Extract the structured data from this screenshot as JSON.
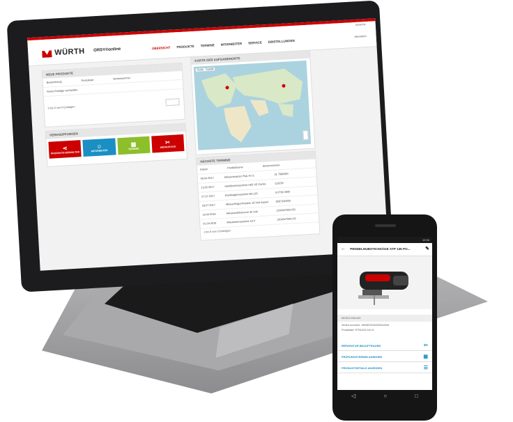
{
  "laptop": {
    "top_links": "Sprache",
    "logo_text": "WÜRTH",
    "logo_sub": "ORSY®online",
    "nav": [
      "ÜBERSICHT",
      "PRODUKTE",
      "TERMINE",
      "MITARBEITER",
      "SERVICE",
      "EINSTELLUNGEN"
    ],
    "logout": "Abmelden",
    "panel_new": {
      "title": "NEUE PRODUKTE",
      "columns": [
        "Bezeichnung",
        "Produktart",
        "Seriennummer"
      ],
      "empty": "Keine Einträge vorhanden",
      "paging": "0 bis 0 von 0 Einträgen"
    },
    "panel_shortcuts": {
      "title": "VERKNÜPFUNGEN",
      "tiles": [
        {
          "label": "PRODUKTEVERWALTEN",
          "icon": "share-icon",
          "color": "#cc0000"
        },
        {
          "label": "MITARBEITER",
          "icon": "user-icon",
          "color": "#1a8fc4"
        },
        {
          "label": "TERMINE",
          "icon": "calendar-icon",
          "color": "#8cbf2a"
        },
        {
          "label": "WERKZEUGE",
          "icon": "tools-icon",
          "color": "#cc0000"
        }
      ]
    },
    "panel_map": {
      "title": "KARTE DER AUFGABENORTE",
      "map_tabs": [
        "Karte",
        "Satellit"
      ]
    },
    "panel_dates": {
      "title": "NÄCHSTE TERMINE",
      "columns": [
        "Datum",
        "Produktname",
        "Seriennummer"
      ],
      "rows": [
        [
          "09.04.2017",
          "Akkuschrauber Pluk 4V S",
          "31 7868490"
        ],
        [
          "13.02.2017",
          "Handbohrmaschine H65 XE Combi",
          "113235"
        ],
        [
          "27.07.2017",
          "Bandsägemaschine BA 125",
          "8 0736 0500"
        ],
        [
          "29.07.2017",
          "Akkuschlagschrauber 18 Volt Impact",
          "6567240200"
        ],
        [
          "18.04.2018",
          "Akkukombihammer 36 Volt",
          "1204347000 DS"
        ],
        [
          "01.04.2018",
          "Akkubohrmaschine 18 V",
          "1204347000 DS"
        ]
      ],
      "paging": "1 bis 6 von 6 Einträgen"
    }
  },
  "phone": {
    "status_time": "12:34",
    "title": "PENDELHUBSTICHSÄGE STP 135 PO...",
    "info_label": "BEZEICHNUNG",
    "detail_lines": [
      "Serien-nummer: 1890675132300012344",
      "Produktart: STHL613  1e1   6"
    ],
    "list": [
      {
        "label": "REPARATUR BEAUFTRAGEN",
        "icon": "tools-icon"
      },
      {
        "label": "PRÜFUNGSTERMIN ANSEHEN",
        "icon": "calendar-icon"
      },
      {
        "label": "PRODUKTDETAILS ANZEIGEN",
        "icon": "list-icon"
      }
    ]
  }
}
